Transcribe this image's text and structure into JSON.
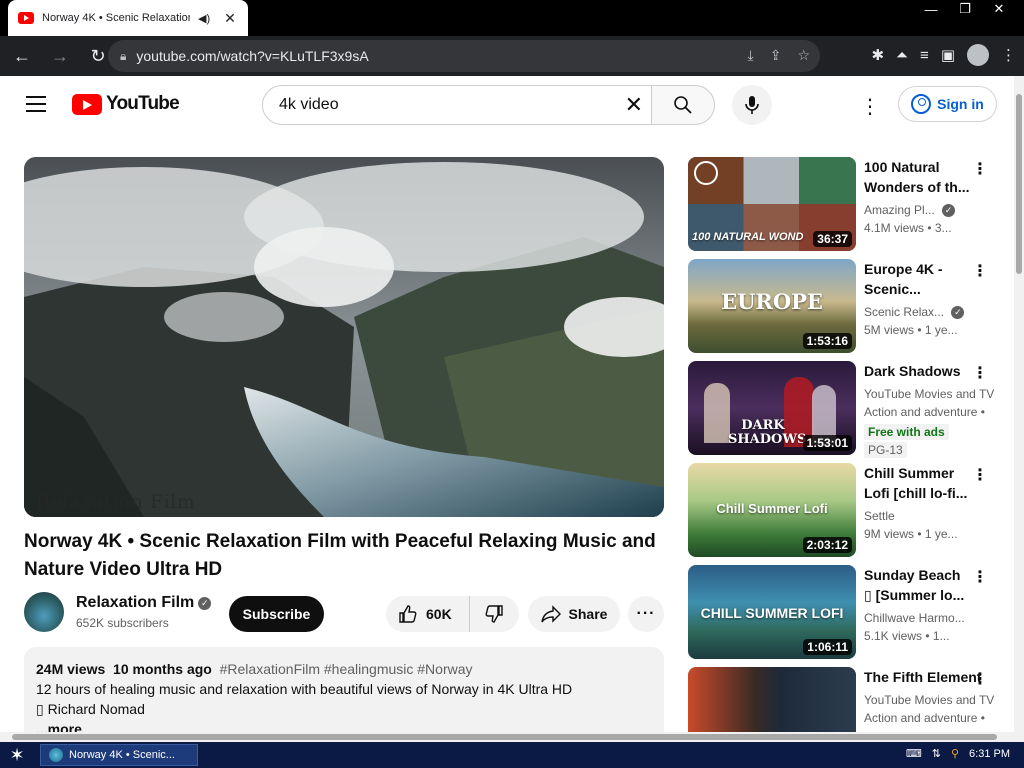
{
  "browser": {
    "tab_title": "Norway 4K • Scenic Relaxation",
    "url": "youtube.com/watch?v=KLuTLF3x9sA",
    "audio_icon": "speaker-icon",
    "close_icon": "close-icon"
  },
  "header": {
    "logo_text": "YouTube",
    "search_query": "4k video",
    "signin_label": "Sign in"
  },
  "video": {
    "title": "Norway 4K • Scenic Relaxation Film with Peaceful Relaxing Music and Nature Video Ultra HD",
    "watermark": "Relaxation Film",
    "channel_name": "Relaxation Film",
    "subscribers": "652K subscribers",
    "subscribe_label": "Subscribe",
    "likes": "60K",
    "share_label": "Share",
    "views": "24M views",
    "age": "10 months ago",
    "hashtags": "#RelaxationFilm #healingmusic #Norway",
    "description_line1": "12 hours of healing music and relaxation with beautiful views of Norway in 4K Ultra HD",
    "description_line2": "▯ Richard Nomad",
    "more_label": "...more"
  },
  "recommendations": [
    {
      "title": "100 Natural Wonders of th...",
      "channel": "Amazing Pl...",
      "meta": "4.1M views • 3...",
      "duration": "36:37",
      "thumb_text": "100 NATURAL WOND",
      "verified": true
    },
    {
      "title": "Europe 4K - Scenic...",
      "channel": "Scenic Relax...",
      "meta": "5M views • 1 ye...",
      "duration": "1:53:16",
      "thumb_text": "EUROPE",
      "verified": true
    },
    {
      "title": "Dark Shadows",
      "channel": "YouTube Movies and TV",
      "meta": "Action and adventure •",
      "duration": "1:53:01",
      "thumb_text": "DARK SHADOWS",
      "badge_free": "Free with ads",
      "badge_rating": "PG-13"
    },
    {
      "title": "Chill Summer Lofi [chill lo-fi...",
      "channel": "Settle",
      "meta": "9M views • 1 ye...",
      "duration": "2:03:12",
      "thumb_text": "Chill Summer Lofi"
    },
    {
      "title": "Sunday Beach ▯ [Summer lo...",
      "channel": "Chillwave Harmo...",
      "meta": "5.1K views • 1...",
      "duration": "1:06:11",
      "thumb_text": "CHILL SUMMER LOFI"
    },
    {
      "title": "The Fifth Element",
      "channel": "YouTube Movies and TV",
      "meta": "Action and adventure •",
      "duration": "",
      "thumb_text": ""
    }
  ],
  "taskbar": {
    "item_label": "Norway 4K • Scenic...",
    "clock": "6:31 PM"
  },
  "colors": {
    "brand_red": "#ff0000",
    "link_blue": "#065fd4",
    "chrome_dark": "#202124",
    "taskbar": "#0a1a44"
  }
}
